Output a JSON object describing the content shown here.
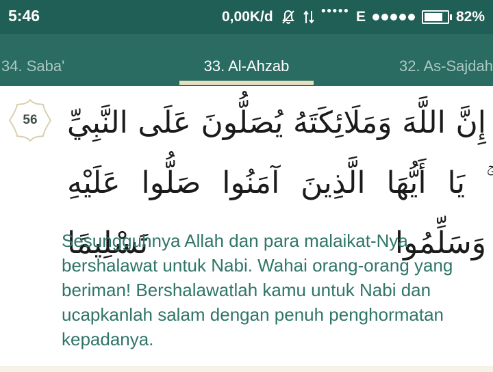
{
  "status_bar": {
    "time": "5:46",
    "data_speed": "0,00K/d",
    "network_type": "E",
    "battery_percent": "82%",
    "battery_level": 0.82,
    "icons": [
      "bell-off-icon",
      "data-transfer-icon",
      "signal-icon",
      "battery-icon"
    ]
  },
  "tabs": {
    "prev": "34. Saba'",
    "current": "33. Al-Ahzab",
    "next": "32. As-Sajdah"
  },
  "ayah": {
    "number": "56",
    "arabic": "إِنَّ اللَّهَ وَمَلَائِكَتَهُ يُصَلُّونَ عَلَى النَّبِيِّ ۚ يَا أَيُّهَا الَّذِينَ آمَنُوا صَلُّوا عَلَيْهِ وَسَلِّمُوا تَسْلِيمًا",
    "translation": "Sesungguhnya Allah dan para malaikat-Nya bershalawat untuk Nabi. Wahai orang-orang yang beriman! Bershalawatlah kamu untuk Nabi dan ucapkanlah salam dengan penuh penghormatan kepadanya."
  },
  "colors": {
    "status_bar": "#1f5f55",
    "tab_bar": "#2a6c62",
    "tab_indicator": "#e9e0c2",
    "translation_text": "#2f7568",
    "badge_border": "#d8cfae"
  }
}
